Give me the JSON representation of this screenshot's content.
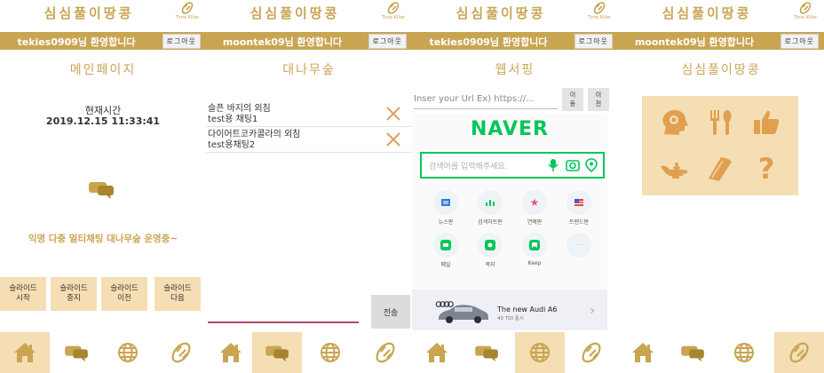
{
  "app": {
    "title": "심심풀이땅콩",
    "logo_text": "Time Killer"
  },
  "colors": {
    "accent": "#c9a552",
    "accent_light": "#f5deb3",
    "naver_green": "#03c75a",
    "underline": "#b0466f"
  },
  "logout_label": "로그아웃",
  "screens": [
    {
      "welcome": "tekies0909님 환영합니다",
      "page_title": "메인페이지",
      "time_label": "현재시간",
      "time_value": "2019.12.15 11:33:41",
      "announcement": "익명 다중 멀티채팅 대나무숲 운영중~",
      "slide_buttons": [
        "슬라이드\n시작",
        "슬라이드\n중지",
        "슬라이드\n이전",
        "슬라이드\n다음"
      ],
      "active_nav": "home"
    },
    {
      "welcome": "moontek09님 환영합니다",
      "page_title": "대나무숲",
      "messages": [
        {
          "line1": "슬픈 바지의 외침",
          "line2": "test용 채팅1"
        },
        {
          "line1": "다이어트코카콜라의 외침",
          "line2": "test용채팅2"
        }
      ],
      "message_input": "",
      "send_label": "전송",
      "active_nav": "chat"
    },
    {
      "welcome": "tekies0909님 환영합니다",
      "page_title": "웹서핑",
      "url_placeholder": "Inser your Url Ex) https://...",
      "move_label": "이\n동",
      "back_label": "이\n전",
      "web": {
        "logo": "NAVER",
        "search_placeholder": "검색어를 입력해주세요.",
        "shortcuts": [
          "뉴스판",
          "검색차트판",
          "연예판",
          "트렌드판",
          "메일",
          "쪽지",
          "Keep",
          ""
        ],
        "ad_brand": "Audi",
        "ad_title": "The new Audi A6",
        "ad_sub": "40 TDI 출시"
      },
      "active_nav": "web"
    },
    {
      "welcome": "moontek09님 환영합니다",
      "page_title": "심심풀이땅콩",
      "menu_icons": [
        "head-gears-icon",
        "fork-spoon-icon",
        "thumbs-up-icon",
        "magic-lamp-icon",
        "book-icon",
        "question-mark-icon"
      ],
      "active_nav": "menu"
    }
  ],
  "nav_items": [
    "home-icon",
    "chat-icon",
    "globe-icon",
    "peanut-icon"
  ]
}
